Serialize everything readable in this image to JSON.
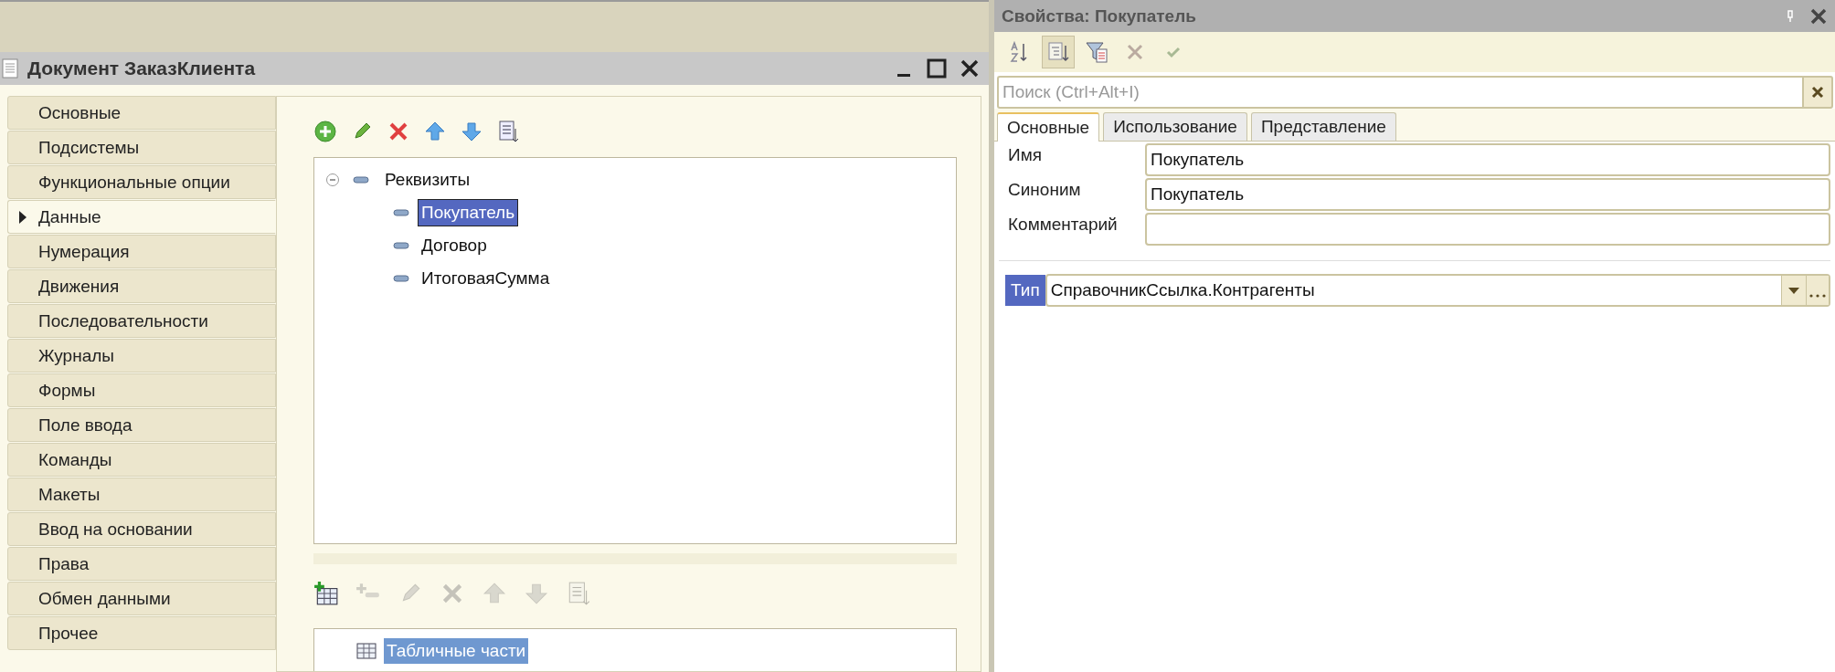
{
  "window": {
    "title": "Документ ЗаказКлиента"
  },
  "sidebar": {
    "items": [
      {
        "label": "Основные",
        "selected": false
      },
      {
        "label": "Подсистемы",
        "selected": false
      },
      {
        "label": "Функциональные опции",
        "selected": false
      },
      {
        "label": "Данные",
        "selected": true
      },
      {
        "label": "Нумерация",
        "selected": false
      },
      {
        "label": "Движения",
        "selected": false
      },
      {
        "label": "Последовательности",
        "selected": false
      },
      {
        "label": "Журналы",
        "selected": false
      },
      {
        "label": "Формы",
        "selected": false
      },
      {
        "label": "Поле ввода",
        "selected": false
      },
      {
        "label": "Команды",
        "selected": false
      },
      {
        "label": "Макеты",
        "selected": false
      },
      {
        "label": "Ввод на основании",
        "selected": false
      },
      {
        "label": "Права",
        "selected": false
      },
      {
        "label": "Обмен данными",
        "selected": false
      },
      {
        "label": "Прочее",
        "selected": false
      }
    ]
  },
  "attributes_toolbar": [
    {
      "kind": "add",
      "disabled": false
    },
    {
      "kind": "edit",
      "disabled": false
    },
    {
      "kind": "delete",
      "disabled": false
    },
    {
      "kind": "up",
      "disabled": false
    },
    {
      "kind": "down",
      "disabled": false
    },
    {
      "kind": "sort",
      "disabled": false
    }
  ],
  "attributes_tree": {
    "label": "Реквизиты",
    "expanded": true,
    "children": [
      {
        "label": "Покупатель",
        "selected": true
      },
      {
        "label": "Договор",
        "selected": false
      },
      {
        "label": "ИтоговаяСумма",
        "selected": false
      }
    ]
  },
  "tabular_toolbar": [
    {
      "kind": "add-table",
      "disabled": false
    },
    {
      "kind": "add-row",
      "disabled": true
    },
    {
      "kind": "edit",
      "disabled": true
    },
    {
      "kind": "delete",
      "disabled": true
    },
    {
      "kind": "up",
      "disabled": true
    },
    {
      "kind": "down",
      "disabled": true
    },
    {
      "kind": "sort",
      "disabled": true
    }
  ],
  "tabular_sections": [
    {
      "label": "Табличные части",
      "selected": true
    }
  ],
  "properties": {
    "title": "Свойства: Покупатель",
    "toolbar": [
      {
        "kind": "sort-alpha",
        "on": false,
        "disabled": false
      },
      {
        "kind": "categories",
        "on": true,
        "disabled": false
      },
      {
        "kind": "filter",
        "on": false,
        "disabled": false
      },
      {
        "kind": "cancel",
        "on": false,
        "disabled": true
      },
      {
        "kind": "apply",
        "on": false,
        "disabled": true
      }
    ],
    "search": {
      "placeholder": "Поиск (Ctrl+Alt+I)"
    },
    "tabs": [
      {
        "label": "Основные",
        "selected": true
      },
      {
        "label": "Использование",
        "selected": false
      },
      {
        "label": "Представление",
        "selected": false
      }
    ],
    "fields": [
      {
        "label": "Имя",
        "value": "Покупатель"
      },
      {
        "label": "Синоним",
        "value": "Покупатель"
      },
      {
        "label": "Комментарий"
      }
    ],
    "type_field": {
      "label": "Тип",
      "value": "СправочникСсылка.Контрагенты"
    }
  }
}
